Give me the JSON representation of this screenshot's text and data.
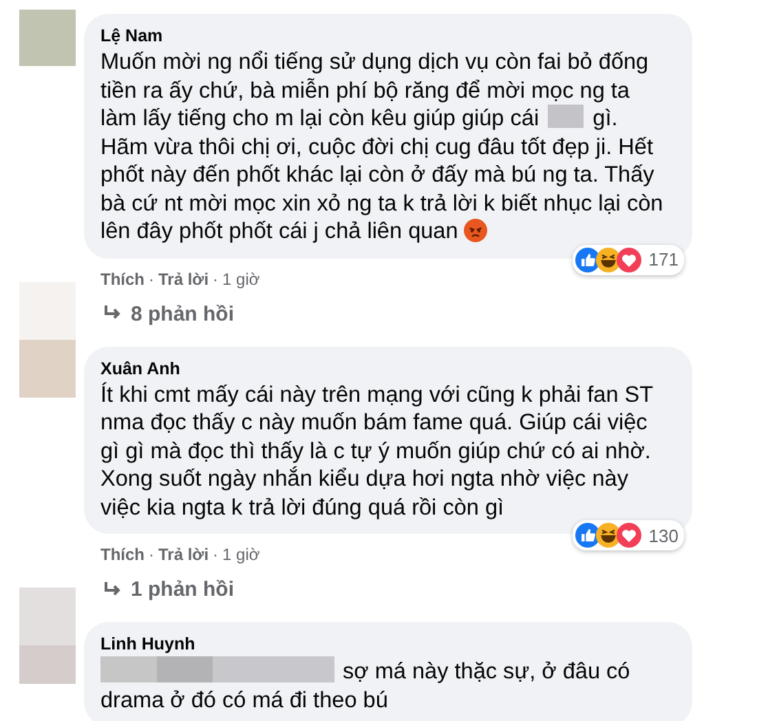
{
  "comments": [
    {
      "author": "Lệ Nam",
      "segments": [
        {
          "kind": "text",
          "text": "Muốn mời ng nổi tiếng sử dụng dịch vụ còn fai bỏ đống tiền ra ấy chứ, bà miễn phí bộ răng để mời mọc ng ta làm lấy tiếng cho m lại còn kêu giúp giúp cái"
        },
        {
          "kind": "redaction"
        },
        {
          "kind": "text",
          "text": "gì. Hãm vừa thôi chị ơi, cuộc đời chị cug đâu tốt đẹp ji. Hết phốt này đến phốt khác lại còn ở đấy mà bú ng ta. Thấy bà cứ nt mời mọc xin xỏ ng ta k trả lời k biết nhục lại còn lên đây phốt phốt cái j chả liên quan"
        },
        {
          "kind": "emoji"
        }
      ],
      "reaction_count": "171",
      "actions": [
        {
          "kind": "link",
          "text": "Thích"
        },
        {
          "kind": "sep",
          "text": "·"
        },
        {
          "kind": "link",
          "text": "Trả lời"
        },
        {
          "kind": "sep",
          "text": "·"
        },
        {
          "kind": "time",
          "text": "1 giờ"
        }
      ],
      "replies": "8 phản hồi"
    },
    {
      "author": "Xuân Anh",
      "segments": [
        {
          "kind": "text",
          "text": "Ít khi cmt mấy cái này trên mạng với cũng k phải fan ST nma đọc thấy c này muốn bám fame quá. Giúp cái việc gì gì mà đọc thì thấy là c tự ý muốn giúp chứ có ai nhờ. Xong suốt ngày nhắn kiểu dựa hơi ngta nhờ việc này việc kia ngta k trả lời đúng quá rồi còn gì"
        }
      ],
      "reaction_count": "130",
      "actions": [
        {
          "kind": "link",
          "text": "Thích"
        },
        {
          "kind": "sep",
          "text": "·"
        },
        {
          "kind": "link",
          "text": "Trả lời"
        },
        {
          "kind": "sep",
          "text": "·"
        },
        {
          "kind": "time",
          "text": "1 giờ"
        }
      ],
      "replies": "1 phản hồi"
    },
    {
      "author": "Linh Huynh",
      "segments": [
        {
          "kind": "redaction_wide"
        },
        {
          "kind": "text",
          "text": "sợ má này thặc sự, ở đâu có drama ở đó có má đi theo bú"
        }
      ]
    }
  ]
}
